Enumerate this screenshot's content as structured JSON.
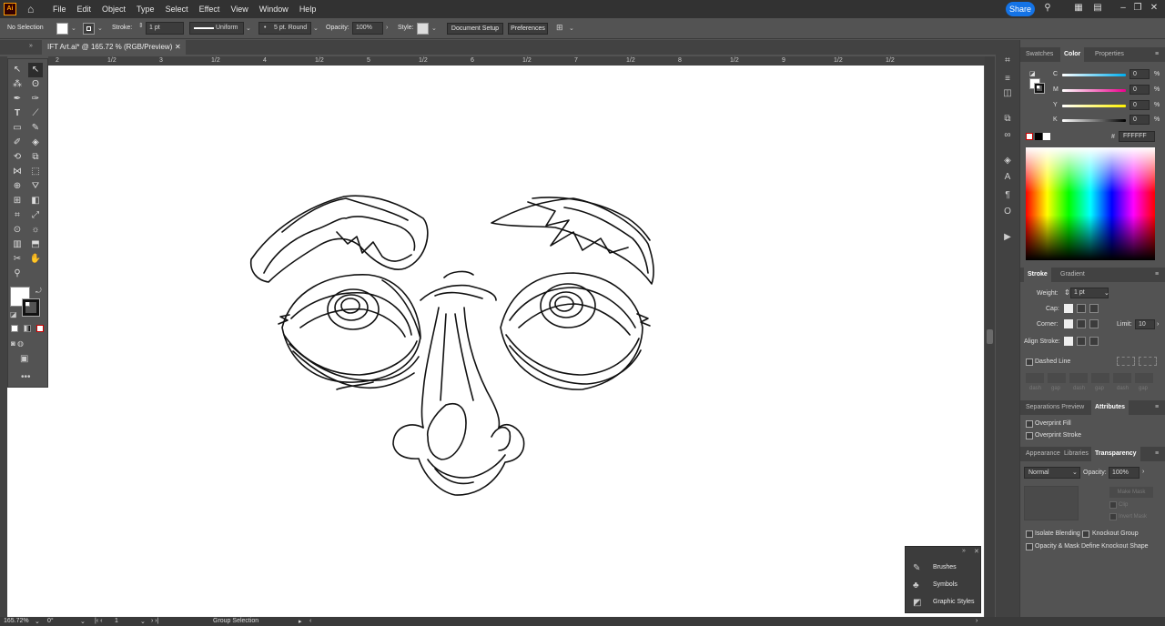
{
  "menubar": {
    "logo": "Ai",
    "items": [
      "File",
      "Edit",
      "Object",
      "Type",
      "Select",
      "Effect",
      "View",
      "Window",
      "Help"
    ],
    "share": "Share"
  },
  "control": {
    "selection": "No Selection",
    "stroke_label": "Stroke:",
    "stroke_value": "1 pt",
    "profile": "Uniform",
    "brush": "5 pt. Round",
    "opacity_label": "Opacity:",
    "opacity_value": "100%",
    "style_label": "Style:",
    "document_setup": "Document Setup",
    "preferences": "Preferences"
  },
  "document": {
    "tab_title": "IFT Art.ai* @ 165.72 % (RGB/Preview)"
  },
  "ruler": {
    "labels": [
      "2",
      "1/2",
      "3",
      "1/2",
      "4",
      "1/2",
      "5",
      "1/2",
      "6",
      "1/2",
      "7",
      "1/2",
      "8",
      "1/2",
      "9",
      "1/2",
      "1/2"
    ]
  },
  "color_panel": {
    "tabs": [
      "Swatches",
      "Color",
      "Properties"
    ],
    "active": "Color",
    "channels": [
      {
        "label": "C",
        "value": "0",
        "unit": "%"
      },
      {
        "label": "M",
        "value": "0",
        "unit": "%"
      },
      {
        "label": "Y",
        "value": "0",
        "unit": "%"
      },
      {
        "label": "K",
        "value": "0",
        "unit": "%"
      }
    ],
    "hex": "FFFFFF",
    "hex_symbol": "#"
  },
  "stroke_panel": {
    "tabs": [
      "Stroke",
      "Gradient"
    ],
    "weight_label": "Weight:",
    "weight_value": "1 pt",
    "cap_label": "Cap:",
    "corner_label": "Corner:",
    "limit_label": "Limit:",
    "limit_value": "10",
    "align_label": "Align Stroke:",
    "dashed_line": "Dashed Line",
    "dash_labels": [
      "dash",
      "gap",
      "dash",
      "gap",
      "dash",
      "gap"
    ]
  },
  "attributes_panel": {
    "tabs": [
      "Separations Preview",
      "Attributes"
    ],
    "overprint_fill": "Overprint Fill",
    "overprint_stroke": "Overprint Stroke"
  },
  "transparency_panel": {
    "tabs": [
      "Appearance",
      "Libraries",
      "Transparency"
    ],
    "blend_mode": "Normal",
    "opacity_label": "Opacity:",
    "opacity_value": "100%",
    "make_mask": "Make Mask",
    "clip": "Clip",
    "invert_mask": "Invert Mask",
    "isolate_blending": "Isolate Blending",
    "knockout_group": "Knockout Group",
    "opacity_mask": "Opacity & Mask Define Knockout Shape"
  },
  "float_panel": {
    "items": [
      "Brushes",
      "Symbols",
      "Graphic Styles"
    ]
  },
  "status": {
    "zoom": "165.72%",
    "rotation": "0°",
    "artboard": "1",
    "tool": "Group Selection"
  },
  "colors": {
    "accent": "#1473e6",
    "ui_bg": "#535353",
    "dark_bg": "#323232"
  }
}
